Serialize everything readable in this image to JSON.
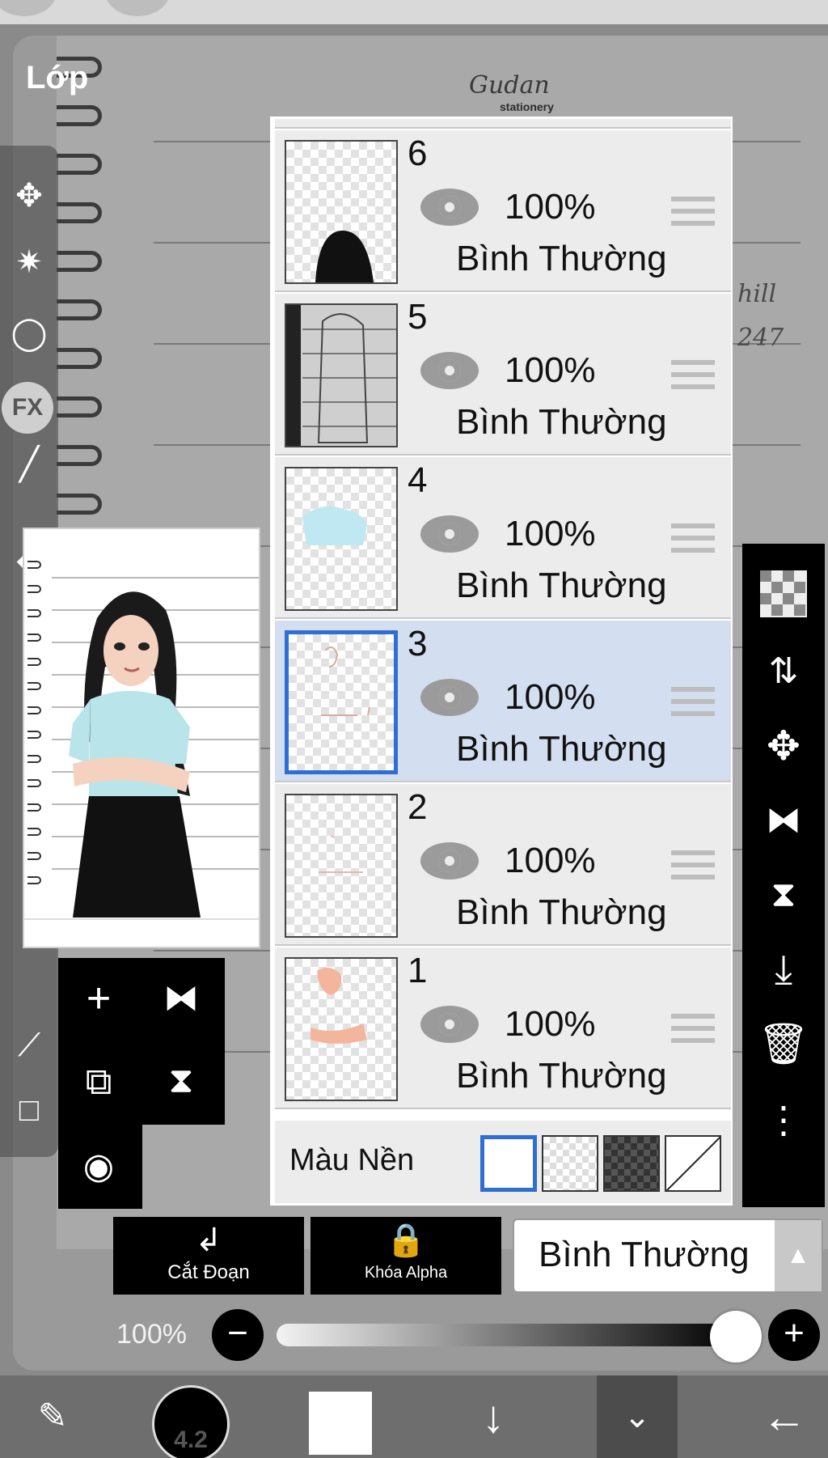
{
  "panel": {
    "title": "Lớp"
  },
  "canvas": {
    "logo_text": "Gudan",
    "logo_sub": "stationery",
    "note_1": "hill",
    "note_2": "247"
  },
  "tools": {
    "left_rail": [
      "move-icon",
      "magic-wand-icon",
      "lasso-icon",
      "fx-icon",
      "brush-icon",
      "filter-icon",
      "divider-icon",
      "eyedropper-icon",
      "canvas-icon"
    ],
    "fx_label": "FX"
  },
  "mini_actions": [
    "add-layer-icon",
    "flip-horizontal-icon",
    "copy-layer-icon",
    "flip-vertical-icon",
    "camera-icon"
  ],
  "layers": [
    {
      "number": "6",
      "opacity": "100%",
      "blend": "Bình Thường",
      "selected": false
    },
    {
      "number": "5",
      "opacity": "100%",
      "blend": "Bình Thường",
      "selected": false
    },
    {
      "number": "4",
      "opacity": "100%",
      "blend": "Bình Thường",
      "selected": false
    },
    {
      "number": "3",
      "opacity": "100%",
      "blend": "Bình Thường",
      "selected": true
    },
    {
      "number": "2",
      "opacity": "100%",
      "blend": "Bình Thường",
      "selected": false
    },
    {
      "number": "1",
      "opacity": "100%",
      "blend": "Bình Thường",
      "selected": false
    }
  ],
  "background": {
    "label": "Màu Nền",
    "options": [
      "white",
      "transparent",
      "dark-checker",
      "none"
    ],
    "selected": "white"
  },
  "right_rail": [
    "checker-icon",
    "swap-layer-icon",
    "move-layer-icon",
    "flip-h-icon",
    "flip-v-icon",
    "merge-down-icon",
    "trash-icon",
    "more-icon"
  ],
  "controls": {
    "clipping_label": "Cắt Đoạn",
    "alpha_lock_label": "Khóa Alpha",
    "blend_mode": "Bình Thường",
    "opacity_label": "100%",
    "opacity_value": 1.0
  },
  "bottom_bar": {
    "brush_size": "4.2",
    "color": "#ffffff",
    "accent": "#2f6fd3"
  }
}
